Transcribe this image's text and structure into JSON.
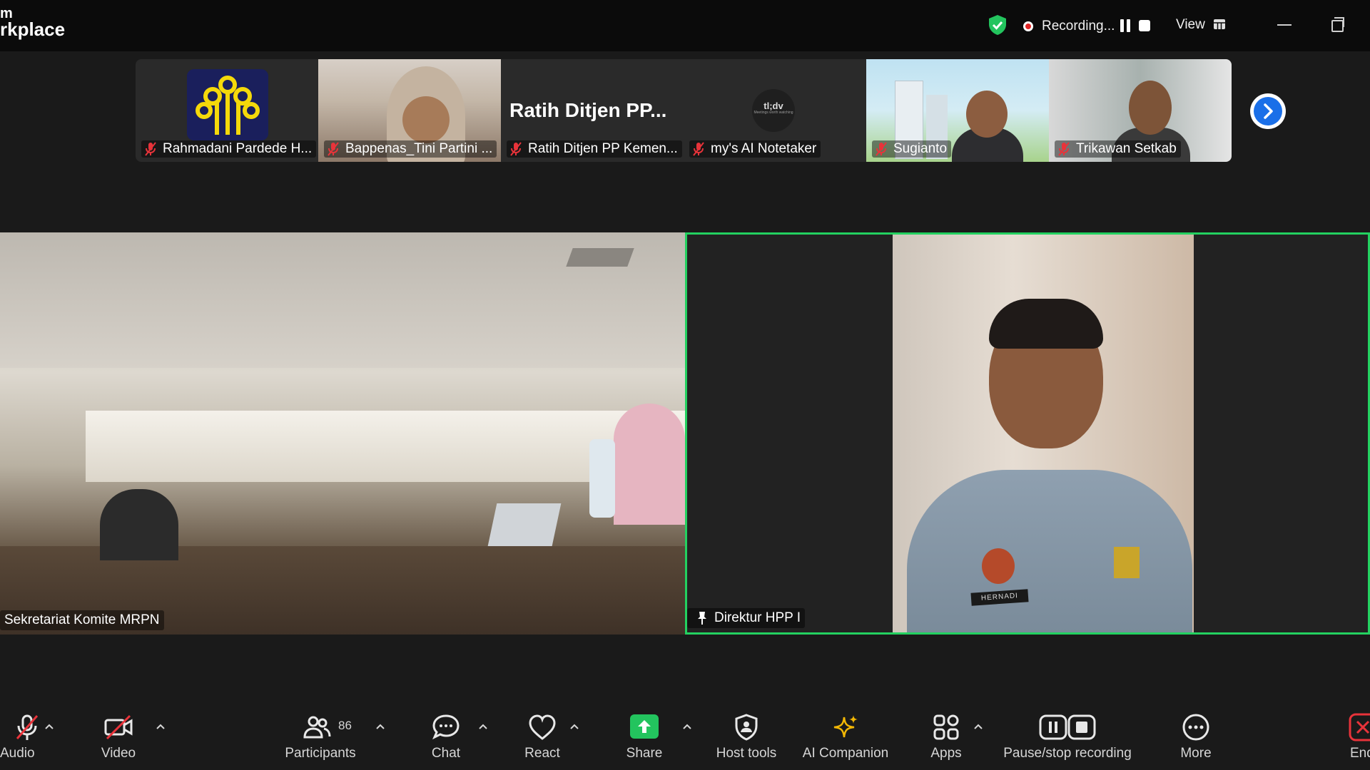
{
  "app": {
    "title_line1": "m",
    "title_line2": "rkplace"
  },
  "header": {
    "recording_label": "Recording...",
    "view_label": "View"
  },
  "gallery": [
    {
      "name": "Rahmadani Pardede H...",
      "muted": true
    },
    {
      "name": "Bappenas_Tini Partini ...",
      "muted": true
    },
    {
      "name": "Ratih Ditjen PP Kemen...",
      "muted": true,
      "display_text": "Ratih Ditjen PP..."
    },
    {
      "name": "my's AI Notetaker",
      "muted": true,
      "display_text": "tl;dv",
      "display_subtext": "Meetings worth watching"
    },
    {
      "name": "Sugianto",
      "muted": true
    },
    {
      "name": "Trikawan Setkab",
      "muted": true
    }
  ],
  "stage": {
    "left_name": "Sekretariat Komite MRPN",
    "right_name": "Direktur HPP I",
    "nameplate": "HERNADI"
  },
  "toolbar": {
    "audio": "Audio",
    "video": "Video",
    "participants": "Participants",
    "participant_count": "86",
    "chat": "Chat",
    "react": "React",
    "share": "Share",
    "host_tools": "Host tools",
    "ai_companion": "AI Companion",
    "apps": "Apps",
    "pause_stop_recording": "Pause/stop recording",
    "more": "More",
    "end": "End"
  },
  "colors": {
    "active_speaker_border": "#23d160",
    "share_green": "#23c45e",
    "end_red": "#e8333a",
    "next_button": "#1a6fe8"
  }
}
